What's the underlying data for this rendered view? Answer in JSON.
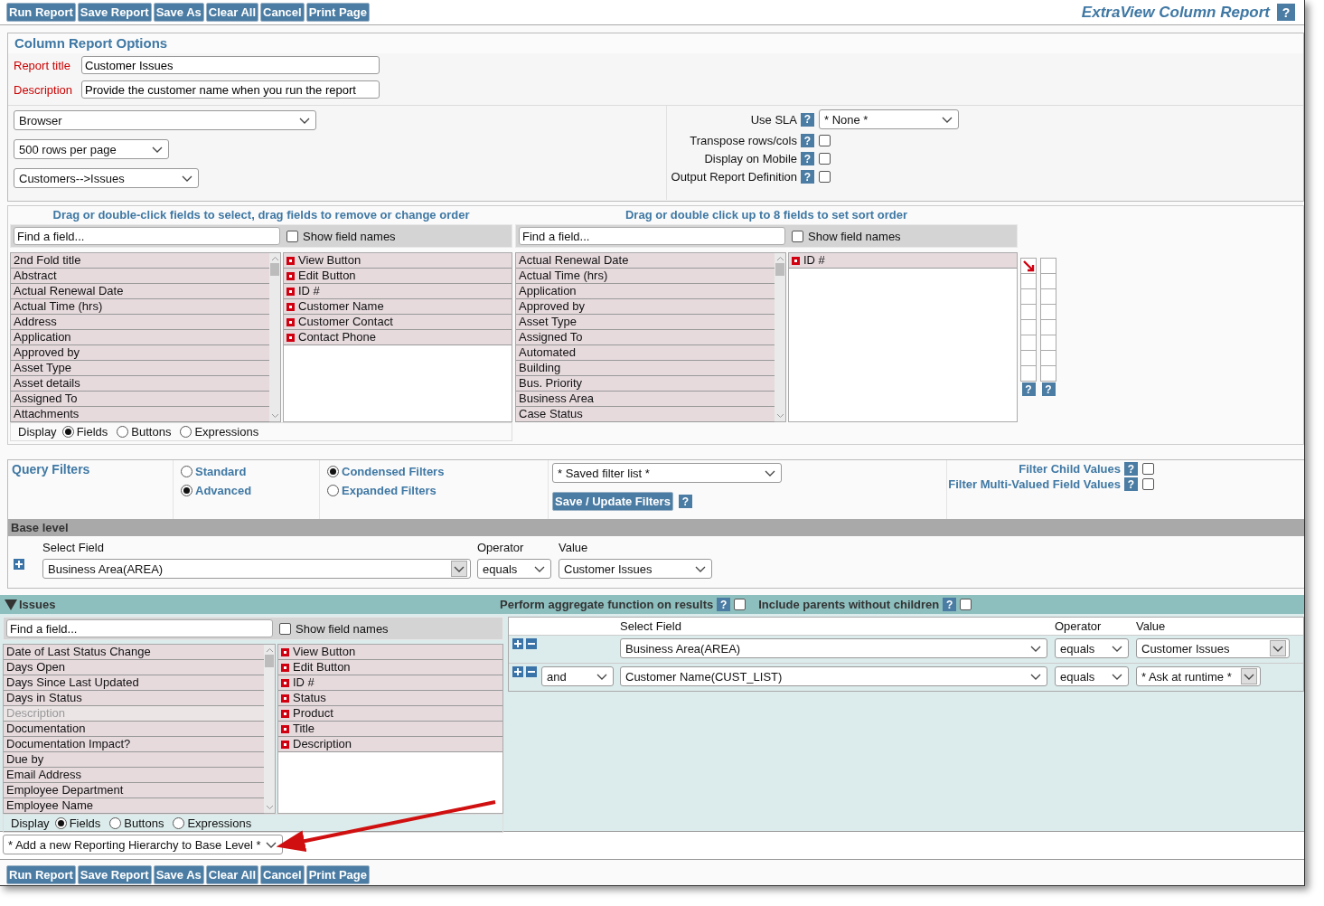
{
  "toolbar_top": {
    "buttons": [
      "Run Report",
      "Save Report",
      "Save As",
      "Clear All",
      "Cancel",
      "Print Page"
    ],
    "title": "ExtraView Column Report",
    "help": "?"
  },
  "options": {
    "heading": "Column Report Options",
    "fields": [
      {
        "label": "Report title",
        "value": "Customer Issues"
      },
      {
        "label": "Description",
        "value": "Provide the customer name when you run the report"
      }
    ],
    "selects": [
      "Browser",
      "500 rows per page",
      "Customers-->Issues"
    ],
    "use_sla": {
      "label": "Use SLA",
      "help": "?",
      "value": "* None *"
    },
    "checks": [
      {
        "label": "Transpose rows/cols",
        "help": "?",
        "checked": false
      },
      {
        "label": "Display on Mobile",
        "help": "?",
        "checked": false
      },
      {
        "label": "Output Report Definition",
        "help": "?",
        "checked": false
      }
    ]
  },
  "field_picker": {
    "heading": "Drag or double-click fields to select, drag fields to remove or change order",
    "search_placeholder": "Find a field...",
    "show_field_names": {
      "label": "Show field names",
      "checked": false
    },
    "available": [
      "2nd Fold title",
      "Abstract",
      "Actual Renewal Date",
      "Actual Time (hrs)",
      "Address",
      "Application",
      "Approved by",
      "Asset Type",
      "Asset details",
      "Assigned To",
      "Attachments"
    ],
    "selected": [
      "View Button",
      "Edit Button",
      "ID #",
      "Customer Name",
      "Customer Contact",
      "Contact Phone"
    ],
    "display": {
      "label": "Display",
      "options": [
        {
          "label": "Fields",
          "selected": true
        },
        {
          "label": "Buttons",
          "selected": false
        },
        {
          "label": "Expressions",
          "selected": false
        }
      ]
    }
  },
  "sort_picker": {
    "heading": "Drag or double click up to 8 fields to set sort order",
    "search_placeholder": "Find a field...",
    "show_field_names": {
      "label": "Show field names",
      "checked": false
    },
    "available": [
      "Actual Renewal Date",
      "Actual Time (hrs)",
      "Application",
      "Approved by",
      "Asset Type",
      "Assigned To",
      "Automated",
      "Building",
      "Bus. Priority",
      "Business Area",
      "Case Status"
    ],
    "selected": [
      "ID #"
    ],
    "sort_columns": [
      {
        "help": "?",
        "slots": [
          {
            "descending": true
          },
          {
            "descending": false
          },
          {
            "descending": false
          },
          {
            "descending": false
          },
          {
            "descending": false
          },
          {
            "descending": false
          },
          {
            "descending": false
          },
          {
            "descending": false
          }
        ]
      },
      {
        "help": "?",
        "slots": [
          {
            "descending": false
          },
          {
            "descending": false
          },
          {
            "descending": false
          },
          {
            "descending": false
          },
          {
            "descending": false
          },
          {
            "descending": false
          },
          {
            "descending": false
          },
          {
            "descending": false
          }
        ]
      }
    ]
  },
  "query_filters": {
    "heading": "Query Filters",
    "modes": [
      {
        "label": "Standard",
        "selected": false
      },
      {
        "label": "Advanced",
        "selected": true
      }
    ],
    "layouts": [
      {
        "label": "Condensed Filters",
        "selected": true
      },
      {
        "label": "Expanded Filters",
        "selected": false
      }
    ],
    "saved_filter": "* Saved filter list *",
    "save_button": "Save / Update Filters",
    "save_help": "?",
    "options": [
      {
        "label": "Filter Child Values",
        "help": "?",
        "checked": false
      },
      {
        "label": "Filter Multi-Valued Field Values",
        "help": "?",
        "checked": false
      }
    ]
  },
  "base_level": {
    "title": "Base level",
    "columns": [
      "Select Field",
      "Operator",
      "Value"
    ],
    "rows": [
      {
        "field": "Business Area(AREA)",
        "operator": "equals",
        "value": "Customer Issues"
      }
    ]
  },
  "issues": {
    "title": "Issues",
    "expanded": true,
    "options": [
      {
        "label": "Perform aggregate function on results",
        "help": "?",
        "checked": false
      },
      {
        "label": "Include parents without children",
        "help": "?",
        "checked": false
      }
    ],
    "field_picker": {
      "search_placeholder": "Find a field...",
      "show_field_names": {
        "label": "Show field names",
        "checked": false
      },
      "available": [
        {
          "label": "Date of Last Status Change",
          "disabled": false
        },
        {
          "label": "Days Open",
          "disabled": false
        },
        {
          "label": "Days Since Last Updated",
          "disabled": false
        },
        {
          "label": "Days in Status",
          "disabled": false
        },
        {
          "label": "Description",
          "disabled": true
        },
        {
          "label": "Documentation",
          "disabled": false
        },
        {
          "label": "Documentation Impact?",
          "disabled": false
        },
        {
          "label": "Due by",
          "disabled": false
        },
        {
          "label": "Email Address",
          "disabled": false
        },
        {
          "label": "Employee Department",
          "disabled": false
        },
        {
          "label": "Employee Name",
          "disabled": false
        }
      ],
      "selected": [
        "View Button",
        "Edit Button",
        "ID #",
        "Status",
        "Product",
        "Title",
        "Description"
      ],
      "display": {
        "label": "Display",
        "options": [
          {
            "label": "Fields",
            "selected": true
          },
          {
            "label": "Buttons",
            "selected": false
          },
          {
            "label": "Expressions",
            "selected": false
          }
        ]
      }
    },
    "filters": {
      "columns": [
        "Select Field",
        "Operator",
        "Value"
      ],
      "rows": [
        {
          "field": "Business Area(AREA)",
          "operator": "equals",
          "value": "Customer Issues"
        },
        {
          "connector": "and",
          "field": "Customer Name(CUST_LIST)",
          "operator": "equals",
          "value": "* Ask at runtime *"
        }
      ]
    }
  },
  "hierarchy_select": "* Add a new Reporting Hierarchy to Base Level *",
  "toolbar_bottom": {
    "buttons": [
      "Run Report",
      "Save Report",
      "Save As",
      "Clear All",
      "Cancel",
      "Print Page"
    ]
  }
}
